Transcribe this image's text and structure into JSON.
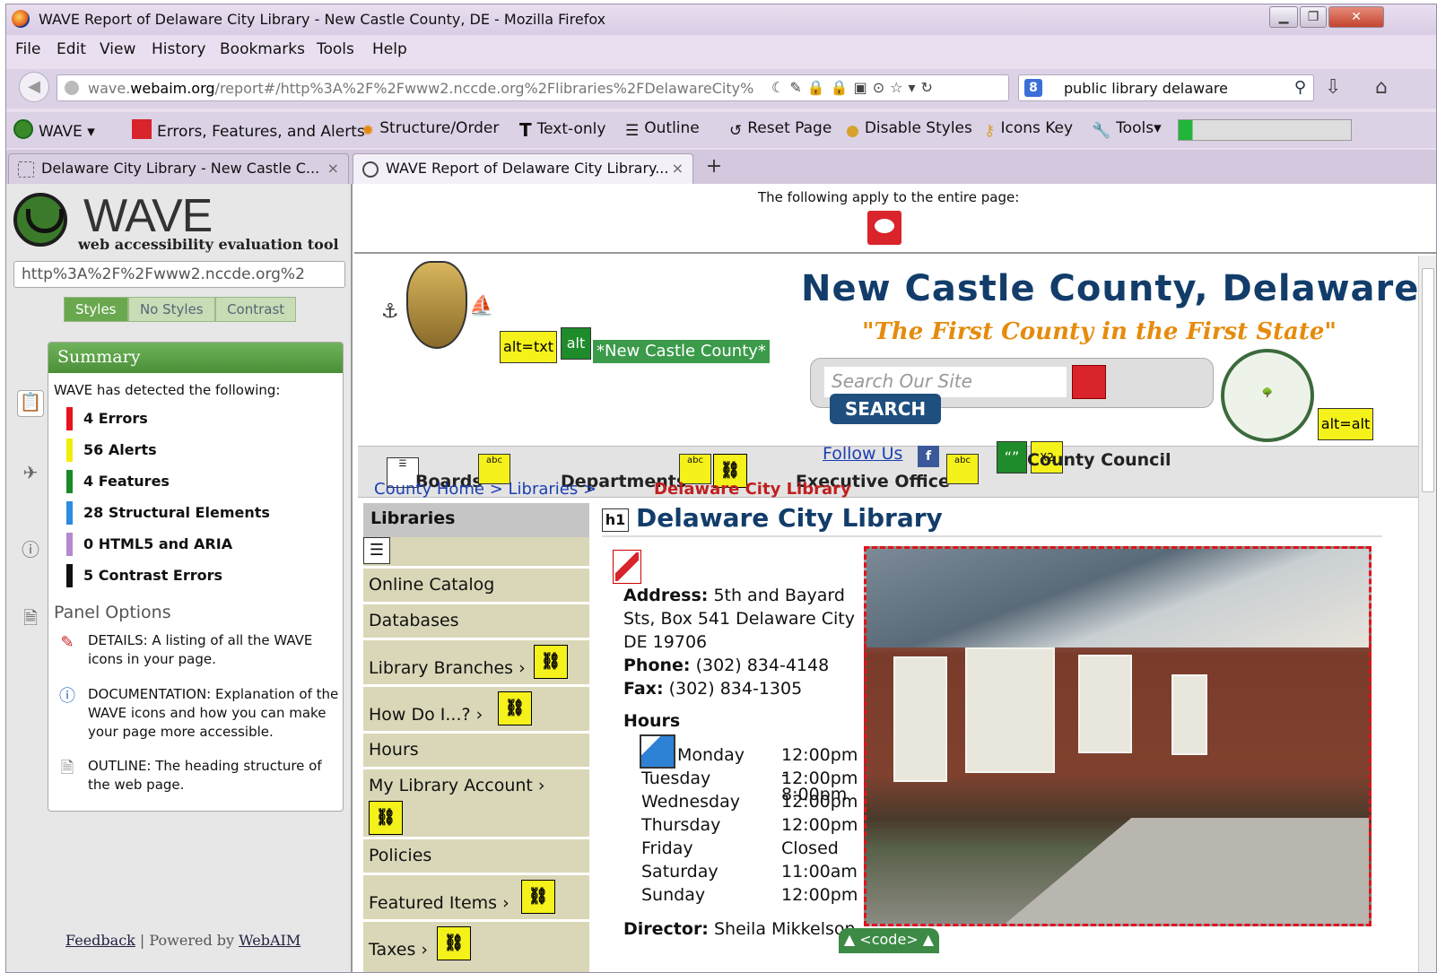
{
  "window": {
    "title": "WAVE Report of Delaware City Library - New Castle County, DE - Mozilla Firefox"
  },
  "menu": [
    "File",
    "Edit",
    "View",
    "History",
    "Bookmarks",
    "Tools",
    "Help"
  ],
  "navbar": {
    "url_prefix": "wave.",
    "url_domain": "webaim.org",
    "url_rest": "/report#/http%3A%2F%2Fwww2.nccde.org%2Flibraries%2FDelawareCity%",
    "search_text": "public library delaware"
  },
  "wave_toolbar": {
    "wave": "WAVE",
    "errors": "Errors, Features, and Alerts",
    "structure": "Structure/Order",
    "textonly": "Text-only",
    "outline": "Outline",
    "reset": "Reset Page",
    "disable": "Disable Styles",
    "iconskey": "Icons Key",
    "tools": "Tools",
    "progress": 0.08
  },
  "tabs": [
    {
      "label": "Delaware City Library - New Castle C..."
    },
    {
      "label": "WAVE Report of Delaware City Library..."
    }
  ],
  "sidebar": {
    "logo_big": "WAVE",
    "logo_small": "web accessibility evaluation tool",
    "url": "http%3A%2F%2Fwww2.nccde.org%2",
    "buttons": [
      "Styles",
      "No Styles",
      "Contrast"
    ],
    "summary_title": "Summary",
    "detected": "WAVE has detected the following:",
    "stats": [
      {
        "label": "4 Errors",
        "color": "#e8131d"
      },
      {
        "label": "56 Alerts",
        "color": "#f2ec0a"
      },
      {
        "label": "4 Features",
        "color": "#1a8a28"
      },
      {
        "label": "28 Structural Elements",
        "color": "#2b8ce0"
      },
      {
        "label": "0 HTML5 and ARIA",
        "color": "#b58ad0"
      },
      {
        "label": "5 Contrast Errors",
        "color": "#111111"
      }
    ],
    "panel_options": "Panel Options",
    "options": [
      {
        "text": "DETAILS: A listing of all the WAVE icons in your page.",
        "icon": "details-icon"
      },
      {
        "text": "DOCUMENTATION: Explanation of the WAVE icons and how you can make your page more accessible.",
        "icon": "info-icon"
      },
      {
        "text": "OUTLINE: The heading structure of the web page.",
        "icon": "outline-icon"
      }
    ],
    "feedback": "Feedback",
    "powered": "Powered by",
    "webaim": "WebAIM"
  },
  "notice": "The following apply to the entire page:",
  "site": {
    "alt_txt": "alt=txt",
    "alt": "alt",
    "alt_eq_alt": "alt=alt",
    "ncc_link": "*New Castle County*",
    "title": "New Castle County, Delaware",
    "tagline": "\"The First County in the First State\"",
    "search_placeholder": "Search Our Site",
    "search_button": "SEARCH",
    "follow_us": "Follow Us",
    "nav": {
      "boards": "Boards",
      "departments": "Departments",
      "executive": "Executive Office",
      "council": "County Council"
    },
    "crumb": "County Home  >  Libraries  >",
    "crumb_current": "Delaware City Library",
    "left_nav": {
      "heading": "Libraries",
      "items": [
        "Online Catalog",
        "Databases",
        "Library Branches ›",
        "How Do I...? ›",
        "Hours",
        "My Library Account ›",
        "Policies",
        "Featured Items ›",
        "Taxes ›"
      ]
    },
    "h1_tag": "h1",
    "h1": "Delaware City Library",
    "address_label": "Address:",
    "address": "5th and Bayard Sts, Box 541 Delaware City DE 19706",
    "phone_label": "Phone:",
    "phone": "(302) 834-4148",
    "fax_label": "Fax:",
    "fax": "(302) 834-1305",
    "hours_title": "Hours",
    "hours": [
      {
        "day": "Monday",
        "time": "12:00pm - 8:00pm"
      },
      {
        "day": "Tuesday",
        "time": "12:00pm"
      },
      {
        "day": "Wednesday",
        "time": "12:00pm"
      },
      {
        "day": "Thursday",
        "time": "12:00pm"
      },
      {
        "day": "Friday",
        "time": "Closed"
      },
      {
        "day": "Saturday",
        "time": "11:00am"
      },
      {
        "day": "Sunday",
        "time": "12:00pm"
      }
    ],
    "director_label": "Director:",
    "director": "Sheila Mikkelson",
    "code": "▲ <code> ▲"
  }
}
